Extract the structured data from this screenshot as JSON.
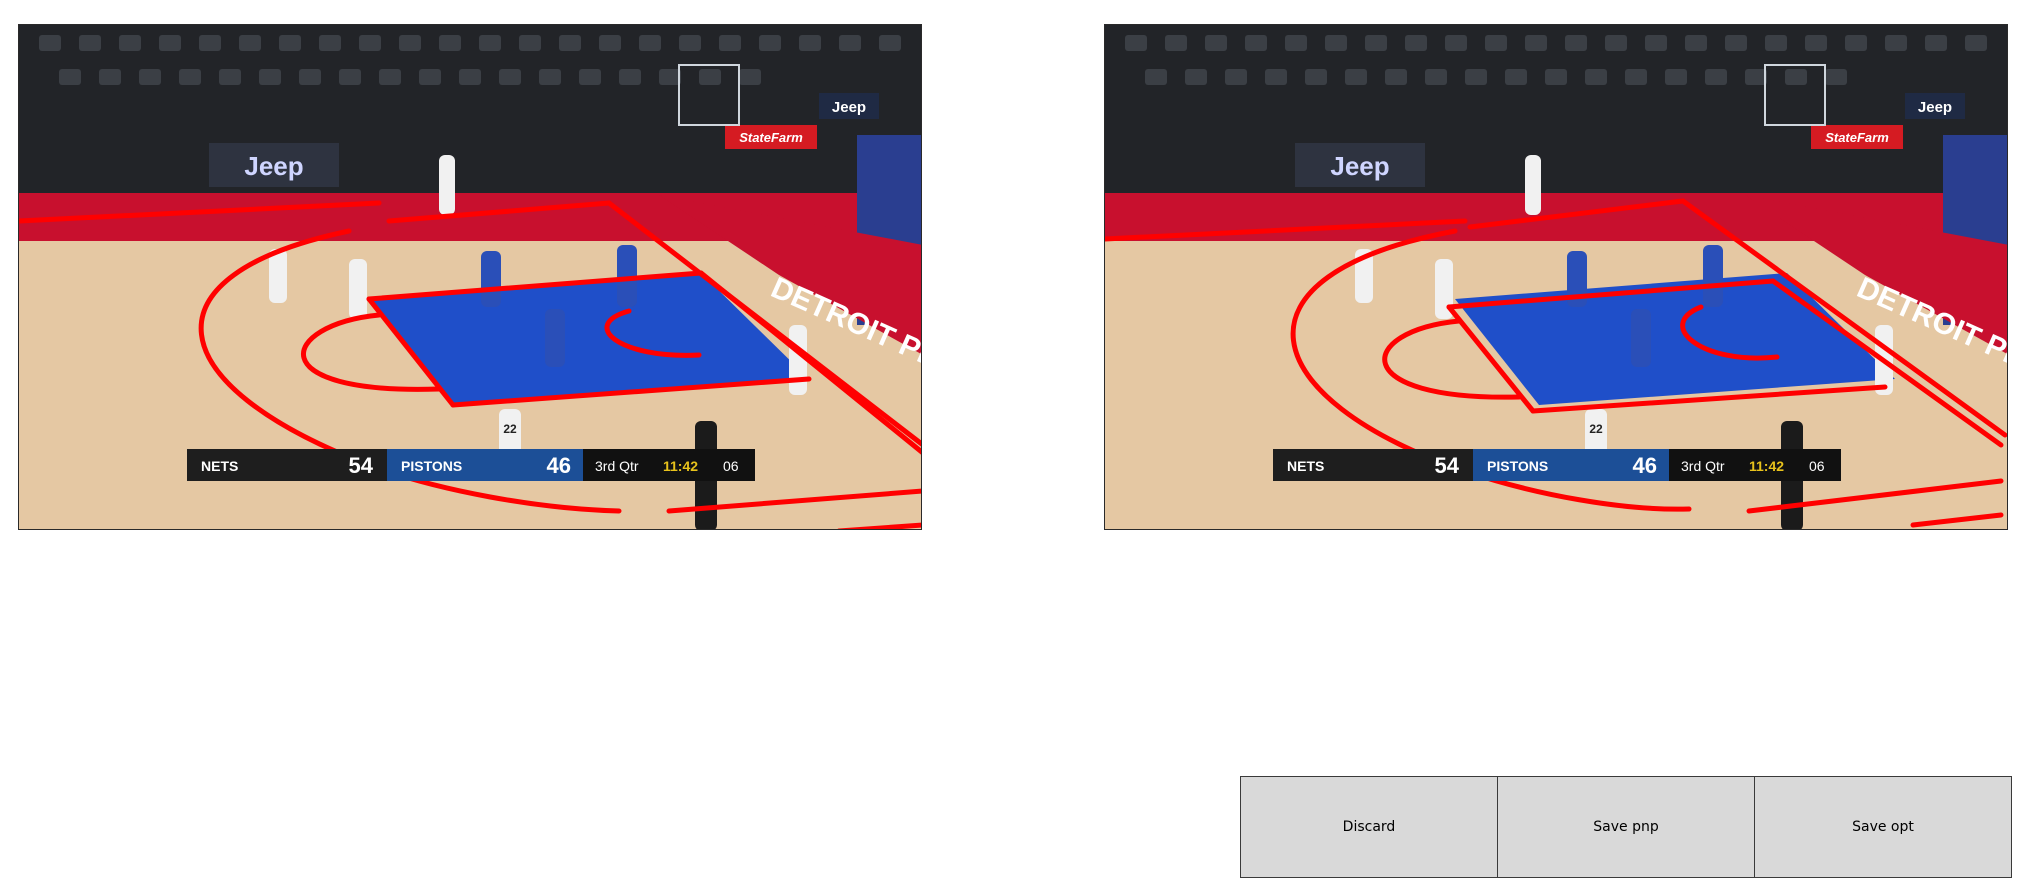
{
  "frames": [
    {
      "id": "left",
      "scorebug": {
        "team1": "NETS",
        "score1": "54",
        "team2": "PISTONS",
        "score2": "46",
        "quarter": "3rd Qtr",
        "clock": "11:42",
        "shot_clock": "06"
      },
      "arena": {
        "banner": "Jeep",
        "sponsor": "StateFarm",
        "baseline": "DETROIT PISTONS",
        "jersey": "22"
      }
    },
    {
      "id": "right",
      "scorebug": {
        "team1": "NETS",
        "score1": "54",
        "team2": "PISTONS",
        "score2": "46",
        "quarter": "3rd Qtr",
        "clock": "11:42",
        "shot_clock": "06"
      },
      "arena": {
        "banner": "Jeep",
        "sponsor": "StateFarm",
        "baseline": "DETROIT PISTONS",
        "jersey": "22"
      }
    }
  ],
  "actions": {
    "discard": "Discard",
    "save_pnp": "Save pnp",
    "save_opt": "Save opt"
  },
  "colors": {
    "overlay_line": "#ff0000",
    "paint": "#1f4fc9",
    "floor": "#e7c9a2",
    "button_bg": "#d9d9d9"
  }
}
